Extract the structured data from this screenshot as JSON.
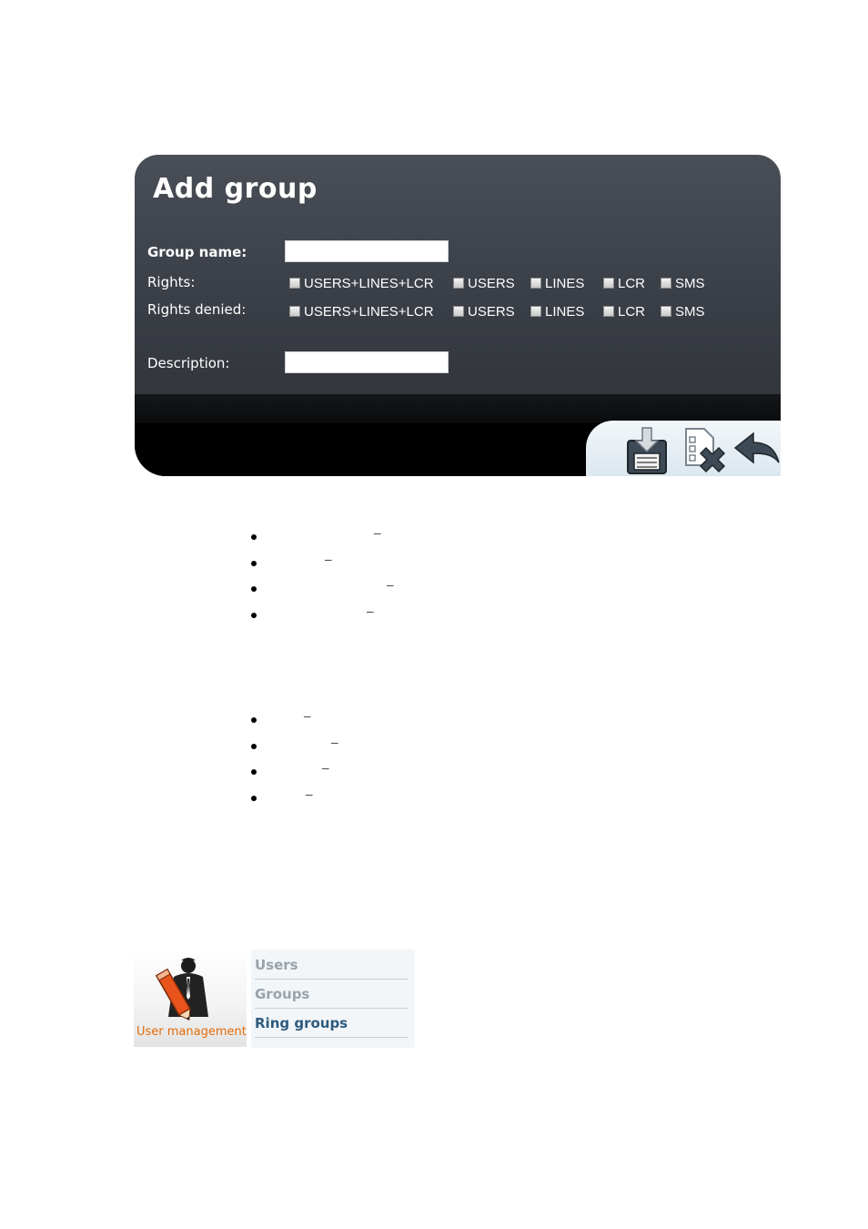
{
  "panel": {
    "title": "Add group",
    "fields": {
      "group_name_label": "Group name:",
      "group_name_value": "",
      "rights_label": "Rights:",
      "rights_denied_label": "Rights denied:",
      "description_label": "Description:",
      "description_value": ""
    },
    "rights_options": [
      "USERS+LINES+LCR",
      "USERS",
      "LINES",
      "LCR",
      "SMS"
    ],
    "rights_denied_options": [
      "USERS+LINES+LCR",
      "USERS",
      "LINES",
      "LCR",
      "SMS"
    ],
    "toolbar_icons": [
      "save-icon",
      "delete-icon",
      "back-icon"
    ]
  },
  "list_a": {
    "dash": "–",
    "count": 4
  },
  "list_b": {
    "dash": "–",
    "count": 4
  },
  "menu": {
    "caption": "User management",
    "items": [
      {
        "label": "Users",
        "color": "#9aa3ab"
      },
      {
        "label": "Groups",
        "color": "#9aa3ab"
      },
      {
        "label": "Ring groups",
        "color": "#2e5b7d"
      }
    ]
  }
}
